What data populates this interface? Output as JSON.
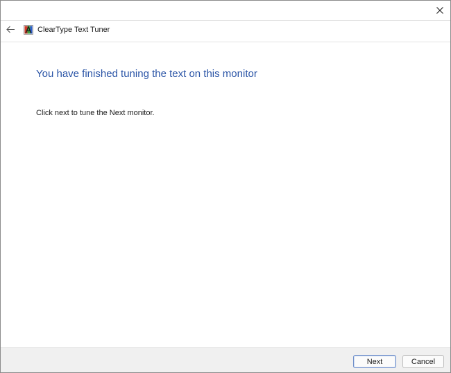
{
  "window": {
    "close_icon": "close-icon"
  },
  "navbar": {
    "back_icon": "back-arrow-icon",
    "app_icon": "cleartype-app-icon",
    "title": "ClearType Text Tuner"
  },
  "content": {
    "heading": "You have finished tuning the text on this monitor",
    "body": "Click next to tune the Next monitor."
  },
  "footer": {
    "next_label": "Next",
    "cancel_label": "Cancel"
  },
  "colors": {
    "heading": "#2a54a6",
    "footer_bg": "#f0f0f0",
    "default_button_border": "#6f8fc9"
  }
}
